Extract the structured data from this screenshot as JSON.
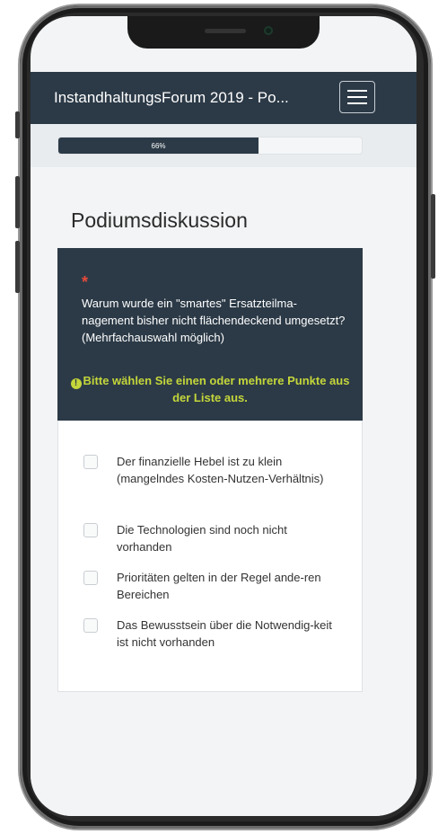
{
  "navbar": {
    "title": "InstandhaltungsForum 2019 - Po..."
  },
  "progress": {
    "value": 0.66,
    "label": "66%"
  },
  "group": {
    "title": "Podiumsdiskussion"
  },
  "question": {
    "required_marker": "*",
    "text": "Warum wurde ein \"smartes\" Ersatzteilma-nagement bisher nicht flächendeckend umgesetzt? (Mehrfachauswahl möglich)",
    "tip": "Bitte wählen Sie einen oder mehrere Punkte aus der Liste aus.",
    "tip_icon": "!"
  },
  "answers": [
    {
      "label": "Der finanzielle Hebel ist zu klein (mangelndes Kosten-Nutzen-Verhältnis)",
      "checked": false
    },
    {
      "label": "Die Technologien sind noch nicht vorhanden",
      "checked": false
    },
    {
      "label": "Prioritäten gelten in der Regel ande-ren Bereichen",
      "checked": false
    },
    {
      "label": "Das Bewusstsein über die Notwendig-keit ist nicht vorhanden",
      "checked": false
    }
  ],
  "colors": {
    "header": "#2c3a47",
    "tip": "#c4d63a",
    "required": "#e64a3b"
  }
}
